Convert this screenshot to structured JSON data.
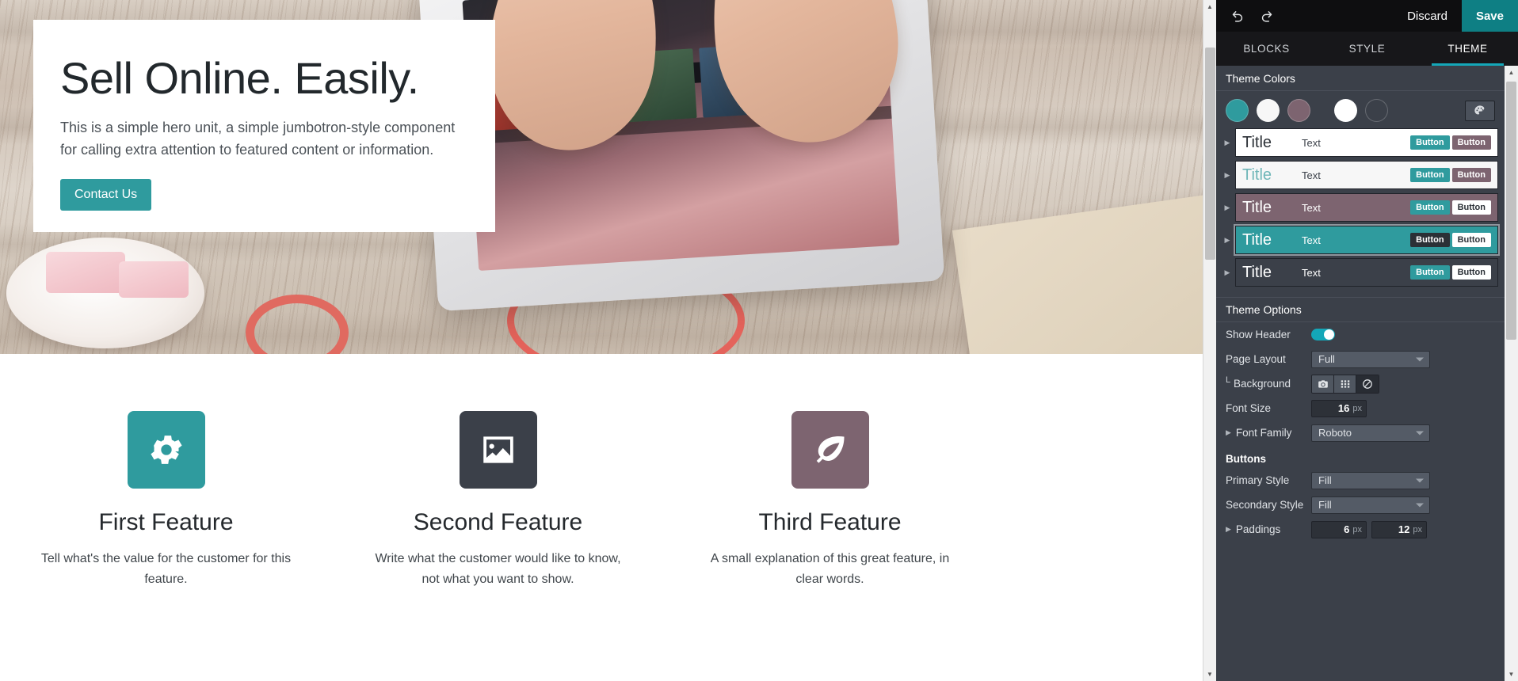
{
  "editor": {
    "toolbar": {
      "undo_icon": "undo-icon",
      "redo_icon": "redo-icon",
      "discard_label": "Discard",
      "save_label": "Save",
      "save_bg": "#0e7f84"
    },
    "tabs": [
      {
        "label": "BLOCKS",
        "active": false
      },
      {
        "label": "STYLE",
        "active": false
      },
      {
        "label": "THEME",
        "active": true
      }
    ],
    "accent_color": "#14a7b8",
    "theme_colors": {
      "section_title": "Theme Colors",
      "swatches": [
        {
          "name": "color-1",
          "hex": "#2f9b9e"
        },
        {
          "name": "color-2",
          "hex": "#f7f7f7"
        },
        {
          "name": "color-3",
          "hex": "#7d6470"
        },
        {
          "name": "color-4",
          "hex": "#ffffff"
        },
        {
          "name": "color-5",
          "hex": "#3b4049"
        }
      ],
      "palette_icon": "palette-icon",
      "presets": [
        {
          "title": "Title",
          "text": "Text",
          "btn1": "Button",
          "btn2": "Button",
          "bg": "#ffffff",
          "title_color": "#2b3036",
          "text_color": "#3b4049",
          "btn1_bg": "#2f9b9e",
          "btn1_fg": "#ffffff",
          "btn2_bg": "#7d6470",
          "btn2_fg": "#ffffff",
          "selected": false
        },
        {
          "title": "Title",
          "text": "Text",
          "btn1": "Button",
          "btn2": "Button",
          "bg": "#f7f7f7",
          "title_color": "#6fb6b8",
          "text_color": "#3b4049",
          "btn1_bg": "#2f9b9e",
          "btn1_fg": "#ffffff",
          "btn2_bg": "#7d6470",
          "btn2_fg": "#ffffff",
          "selected": false
        },
        {
          "title": "Title",
          "text": "Text",
          "btn1": "Button",
          "btn2": "Button",
          "bg": "#7d6470",
          "title_color": "#ffffff",
          "text_color": "#ffffff",
          "btn1_bg": "#2f9b9e",
          "btn1_fg": "#ffffff",
          "btn2_bg": "#ffffff",
          "btn2_fg": "#2b3036",
          "selected": false
        },
        {
          "title": "Title",
          "text": "Text",
          "btn1": "Button",
          "btn2": "Button",
          "bg": "#2f9b9e",
          "title_color": "#ffffff",
          "text_color": "#ffffff",
          "btn1_bg": "#2b3036",
          "btn1_fg": "#ffffff",
          "btn2_bg": "#ffffff",
          "btn2_fg": "#2b3036",
          "selected": true
        },
        {
          "title": "Title",
          "text": "Text",
          "btn1": "Button",
          "btn2": "Button",
          "bg": "#3b4049",
          "title_color": "#ffffff",
          "text_color": "#ffffff",
          "btn1_bg": "#2f9b9e",
          "btn1_fg": "#ffffff",
          "btn2_bg": "#ffffff",
          "btn2_fg": "#2b3036",
          "selected": false
        }
      ]
    },
    "theme_options": {
      "section_title": "Theme Options",
      "show_header": {
        "label": "Show Header",
        "value": "on"
      },
      "page_layout": {
        "label": "Page Layout",
        "value": "Full"
      },
      "background": {
        "label": "Background",
        "modes": [
          {
            "name": "image-background",
            "icon": "camera-icon",
            "active": false
          },
          {
            "name": "pattern-background",
            "icon": "grid-icon",
            "active": false
          },
          {
            "name": "no-background",
            "icon": "no-entry-icon",
            "active": true
          }
        ]
      },
      "font_size": {
        "label": "Font Size",
        "value": "16",
        "unit": "px"
      },
      "font_family": {
        "label": "Font Family",
        "value": "Roboto"
      }
    },
    "buttons_group": {
      "title": "Buttons",
      "primary_style": {
        "label": "Primary Style",
        "value": "Fill"
      },
      "secondary_style": {
        "label": "Secondary Style",
        "value": "Fill"
      },
      "paddings": {
        "label": "Paddings",
        "vertical": "6",
        "vertical_unit": "px",
        "horizontal": "12",
        "horizontal_unit": "px"
      }
    }
  },
  "website": {
    "hero": {
      "title": "Sell Online. Easily.",
      "subtitle": "This is a simple hero unit, a simple jumbotron-style component for calling extra attention to featured content or information.",
      "cta_label": "Contact Us",
      "cta_color": "#2f9b9e"
    },
    "features": [
      {
        "icon": "gear-icon",
        "icon_bg": "#2f9b9e",
        "title": "First Feature",
        "text": "Tell what's the value for the customer for this feature."
      },
      {
        "icon": "image-icon",
        "icon_bg": "#3b4049",
        "title": "Second Feature",
        "text": "Write what the customer would like to know, not what you want to show."
      },
      {
        "icon": "leaf-icon",
        "icon_bg": "#7d6470",
        "title": "Third Feature",
        "text": "A small explanation of this great feature, in clear words."
      }
    ]
  }
}
